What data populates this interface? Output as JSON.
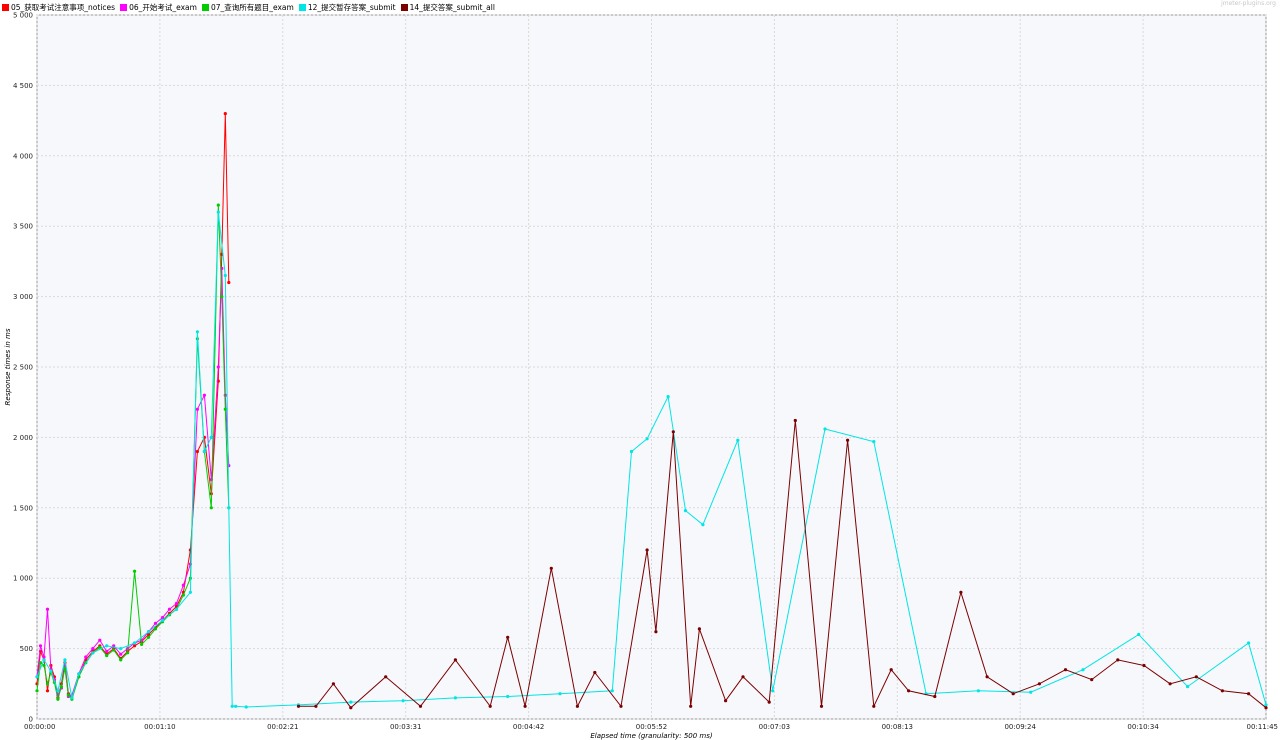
{
  "watermark": "jmeter-plugins.org",
  "chart_data": {
    "type": "line",
    "title": "",
    "xlabel": "Elapsed time (granularity: 500 ms)",
    "ylabel": "Response times in ms",
    "ylim": [
      0,
      5000
    ],
    "xlim_seconds": [
      0,
      705
    ],
    "x_unit": "elapsed time",
    "grid": true,
    "legend_position": "top-left",
    "x_ticks": [
      "00:00:00",
      "00:01:10",
      "00:02:21",
      "00:03:31",
      "00:04:42",
      "00:05:52",
      "00:07:03",
      "00:08:13",
      "00:09:24",
      "00:10:34",
      "00:11:45"
    ],
    "y_ticks": [
      "0",
      "500",
      "1 000",
      "1 500",
      "2 000",
      "2 500",
      "3 000",
      "3 500",
      "4 000",
      "4 500",
      "5 000"
    ],
    "series": [
      {
        "name": "05_获取考试注意事项_notices",
        "color": "#ff0000",
        "x": [
          "00:00:00",
          "00:00:02",
          "00:00:04",
          "00:00:06",
          "00:00:08",
          "00:00:10",
          "00:00:12",
          "00:00:14",
          "00:00:16",
          "00:00:18",
          "00:00:20",
          "00:00:24",
          "00:00:28",
          "00:00:32",
          "00:00:36",
          "00:00:40",
          "00:00:44",
          "00:00:48",
          "00:00:52",
          "00:00:56",
          "00:01:00",
          "00:01:04",
          "00:01:08",
          "00:01:12",
          "00:01:16",
          "00:01:20",
          "00:01:24",
          "00:01:28",
          "00:01:32",
          "00:01:36",
          "00:01:40",
          "00:01:44",
          "00:01:46",
          "00:01:48",
          "00:01:50"
        ],
        "values": [
          250,
          480,
          420,
          200,
          380,
          300,
          150,
          250,
          400,
          180,
          150,
          300,
          420,
          480,
          520,
          460,
          500,
          430,
          480,
          520,
          550,
          600,
          650,
          700,
          750,
          800,
          900,
          1200,
          1900,
          2000,
          1600,
          2400,
          3300,
          4300,
          3100
        ]
      },
      {
        "name": "06_开始考试_exam",
        "color": "#ff00ff",
        "x": [
          "00:00:00",
          "00:00:02",
          "00:00:04",
          "00:00:06",
          "00:00:08",
          "00:00:10",
          "00:00:12",
          "00:00:14",
          "00:00:16",
          "00:00:18",
          "00:00:20",
          "00:00:24",
          "00:00:28",
          "00:00:32",
          "00:00:36",
          "00:00:40",
          "00:00:44",
          "00:00:48",
          "00:00:52",
          "00:00:56",
          "00:01:00",
          "00:01:04",
          "00:01:08",
          "00:01:12",
          "00:01:16",
          "00:01:20",
          "00:01:24",
          "00:01:28",
          "00:01:32",
          "00:01:36",
          "00:01:40",
          "00:01:44",
          "00:01:46",
          "00:01:48",
          "00:01:50"
        ],
        "values": [
          300,
          520,
          440,
          780,
          350,
          280,
          170,
          220,
          380,
          160,
          170,
          320,
          440,
          500,
          560,
          480,
          520,
          460,
          500,
          540,
          560,
          620,
          680,
          720,
          780,
          820,
          950,
          1100,
          2200,
          2300,
          1700,
          2500,
          3200,
          2300,
          1800
        ]
      },
      {
        "name": "07_查询所有题目_exam",
        "color": "#00cc00",
        "x": [
          "00:00:00",
          "00:00:02",
          "00:00:04",
          "00:00:06",
          "00:00:08",
          "00:00:10",
          "00:00:12",
          "00:00:14",
          "00:00:16",
          "00:00:18",
          "00:00:20",
          "00:00:24",
          "00:00:28",
          "00:00:32",
          "00:00:36",
          "00:00:40",
          "00:00:44",
          "00:00:48",
          "00:00:52",
          "00:00:56",
          "00:01:00",
          "00:01:04",
          "00:01:08",
          "00:01:12",
          "00:01:16",
          "00:01:20",
          "00:01:24",
          "00:01:28",
          "00:01:32",
          "00:01:36",
          "00:01:40",
          "00:01:44",
          "00:01:46",
          "00:01:48",
          "00:01:50"
        ],
        "values": [
          200,
          400,
          380,
          250,
          330,
          260,
          140,
          230,
          360,
          170,
          140,
          300,
          400,
          470,
          510,
          450,
          490,
          420,
          470,
          1050,
          530,
          580,
          640,
          690,
          740,
          780,
          880,
          1000,
          2700,
          1900,
          1500,
          3650,
          3000,
          2200,
          1500
        ]
      },
      {
        "name": "12_提交暂存答案_submit",
        "color": "#00e5e5",
        "x": [
          "00:00:00",
          "00:00:04",
          "00:00:08",
          "00:00:12",
          "00:00:16",
          "00:00:20",
          "00:00:24",
          "00:00:32",
          "00:00:40",
          "00:00:48",
          "00:00:56",
          "00:01:04",
          "00:01:12",
          "00:01:20",
          "00:01:28",
          "00:01:32",
          "00:01:36",
          "00:01:40",
          "00:01:44",
          "00:01:48",
          "00:01:50",
          "00:01:52",
          "00:01:54",
          "00:02:00",
          "00:02:30",
          "00:03:00",
          "00:03:30",
          "00:04:00",
          "00:04:30",
          "00:05:00",
          "00:05:30",
          "00:05:41",
          "00:05:50",
          "00:06:02",
          "00:06:12",
          "00:06:22",
          "00:06:42",
          "00:07:02",
          "00:07:32",
          "00:08:00",
          "00:08:30",
          "00:09:00",
          "00:09:30",
          "00:10:00",
          "00:10:32",
          "00:11:00",
          "00:11:35",
          "00:11:45"
        ],
        "values": [
          300,
          420,
          340,
          200,
          420,
          150,
          320,
          470,
          520,
          500,
          540,
          620,
          700,
          780,
          900,
          2750,
          1900,
          2000,
          3600,
          3150,
          1500,
          90,
          90,
          85,
          100,
          120,
          130,
          150,
          160,
          180,
          200,
          1900,
          1990,
          2290,
          1480,
          1380,
          1980,
          200,
          2060,
          1970,
          180,
          200,
          190,
          350,
          600,
          230,
          540,
          100
        ]
      },
      {
        "name": "14_提交答案_submit_all",
        "color": "#7b0000",
        "x": [
          "00:02:30",
          "00:02:40",
          "00:02:50",
          "00:03:00",
          "00:03:20",
          "00:03:40",
          "00:04:00",
          "00:04:20",
          "00:04:30",
          "00:04:40",
          "00:04:55",
          "00:05:10",
          "00:05:20",
          "00:05:35",
          "00:05:50",
          "00:05:55",
          "00:06:05",
          "00:06:15",
          "00:06:20",
          "00:06:35",
          "00:06:45",
          "00:07:00",
          "00:07:15",
          "00:07:30",
          "00:07:45",
          "00:08:00",
          "00:08:10",
          "00:08:20",
          "00:08:35",
          "00:08:50",
          "00:09:05",
          "00:09:20",
          "00:09:35",
          "00:09:50",
          "00:10:05",
          "00:10:20",
          "00:10:35",
          "00:10:50",
          "00:11:05",
          "00:11:20",
          "00:11:35",
          "00:11:45"
        ],
        "values": [
          90,
          90,
          250,
          80,
          300,
          90,
          420,
          90,
          580,
          90,
          1070,
          90,
          330,
          90,
          1200,
          620,
          2040,
          90,
          640,
          130,
          300,
          120,
          2120,
          90,
          1980,
          90,
          350,
          200,
          160,
          900,
          300,
          180,
          250,
          350,
          280,
          420,
          380,
          250,
          300,
          200,
          180,
          80
        ]
      }
    ]
  }
}
